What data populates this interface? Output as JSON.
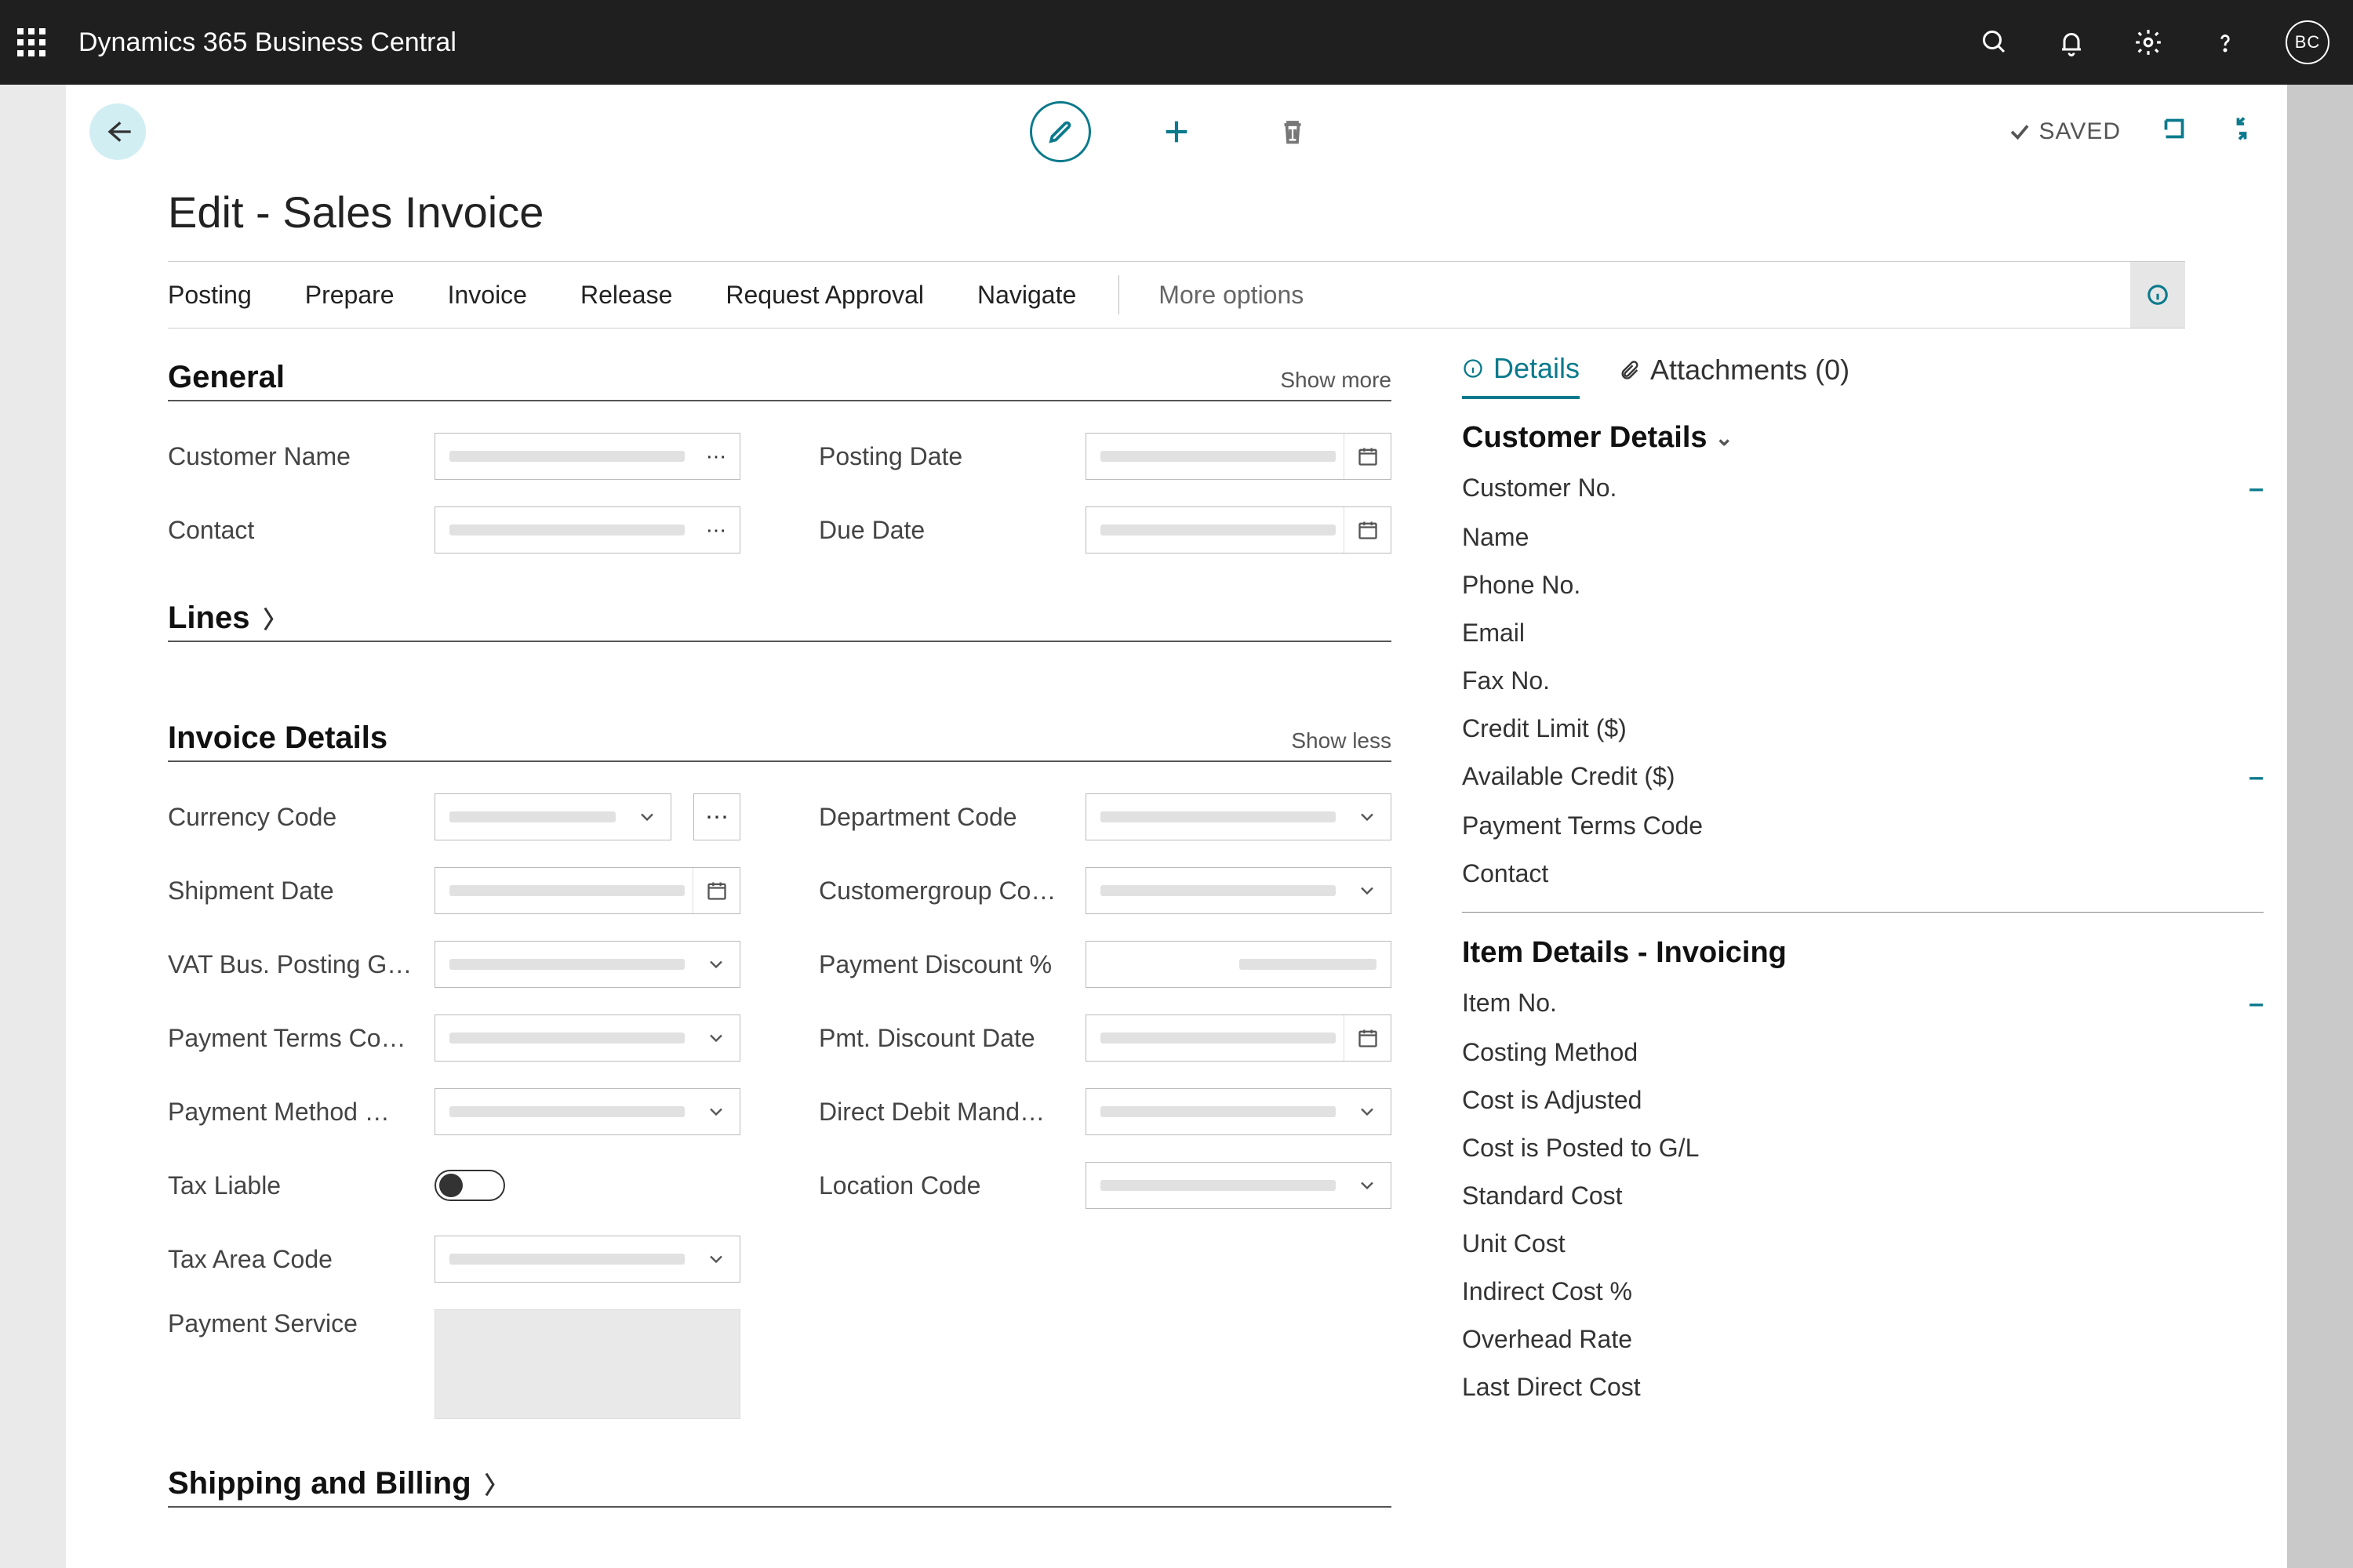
{
  "appbar": {
    "brand": "Dynamics 365 Business Central",
    "avatar": "BC"
  },
  "page": {
    "title": "Edit - Sales Invoice",
    "saved": "SAVED"
  },
  "actionMenu": {
    "tabs": [
      "Posting",
      "Prepare",
      "Invoice",
      "Release",
      "Request Approval",
      "Navigate"
    ],
    "more": "More options"
  },
  "sections": {
    "general": {
      "title": "General",
      "toggle": "Show more"
    },
    "lines": {
      "title": "Lines"
    },
    "invoiceDetails": {
      "title": "Invoice Details",
      "toggle": "Show less"
    },
    "shippingBilling": {
      "title": "Shipping and Billing"
    }
  },
  "generalFields": {
    "left": [
      {
        "label": "Customer Name",
        "style": "ellipsis"
      },
      {
        "label": "Contact",
        "style": "ellipsis"
      }
    ],
    "right": [
      {
        "label": "Posting Date",
        "style": "date"
      },
      {
        "label": "Due Date",
        "style": "date"
      }
    ]
  },
  "invoiceFields": {
    "left": [
      {
        "label": "Currency Code",
        "style": "select-ellipsis"
      },
      {
        "label": "Shipment Date",
        "style": "date"
      },
      {
        "label": "VAT Bus. Posting G…",
        "style": "select"
      },
      {
        "label": "Payment Terms Co…",
        "style": "select"
      },
      {
        "label": "Payment Method …",
        "style": "select"
      },
      {
        "label": "Tax Liable",
        "style": "toggle"
      },
      {
        "label": "Tax Area Code",
        "style": "select"
      },
      {
        "label": "Payment Service",
        "style": "bigbox"
      }
    ],
    "right": [
      {
        "label": "Department Code",
        "style": "select"
      },
      {
        "label": "Customergroup Co…",
        "style": "select"
      },
      {
        "label": "Payment Discount %",
        "style": "plain-right"
      },
      {
        "label": "Pmt. Discount Date",
        "style": "date"
      },
      {
        "label": "Direct Debit Mand…",
        "style": "select"
      },
      {
        "label": "Location Code",
        "style": "select"
      }
    ]
  },
  "factbox": {
    "tabs": {
      "details": "Details",
      "attachments": "Attachments (0)"
    },
    "customerDetails": {
      "title": "Customer Details",
      "rows": [
        {
          "label": "Customer No.",
          "value": "–"
        },
        {
          "label": "Name"
        },
        {
          "label": "Phone No."
        },
        {
          "label": "Email"
        },
        {
          "label": "Fax No."
        },
        {
          "label": "Credit Limit ($)"
        },
        {
          "label": "Available Credit ($)",
          "value": "–"
        },
        {
          "label": "Payment Terms Code"
        },
        {
          "label": "Contact"
        }
      ]
    },
    "itemDetails": {
      "title": "Item Details - Invoicing",
      "rows": [
        {
          "label": "Item No.",
          "value": "–"
        },
        {
          "label": "Costing Method"
        },
        {
          "label": "Cost is Adjusted"
        },
        {
          "label": "Cost is Posted to G/L"
        },
        {
          "label": "Standard Cost"
        },
        {
          "label": "Unit Cost"
        },
        {
          "label": "Indirect Cost %"
        },
        {
          "label": "Overhead Rate"
        },
        {
          "label": "Last Direct Cost"
        }
      ]
    }
  }
}
